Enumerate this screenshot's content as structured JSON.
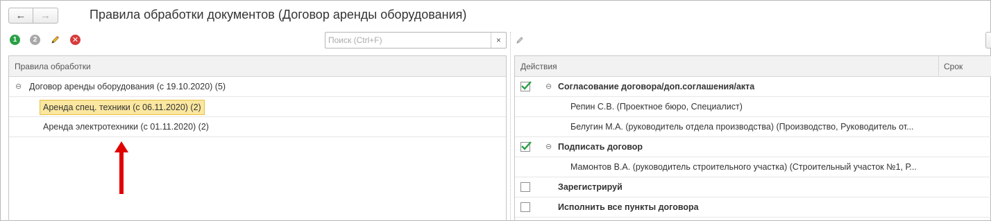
{
  "window": {
    "title": "Правила обработки документов (Договор аренды оборудования)",
    "nav_back": "←",
    "nav_forward": "→"
  },
  "left_toolbar": {
    "icon_1": "1",
    "icon_2": "2",
    "icon_x": "✕",
    "search_placeholder": "Поиск (Ctrl+F)",
    "search_value": "",
    "search_clear": "×"
  },
  "rules_panel": {
    "header": "Правила обработки",
    "rows": [
      {
        "label": "Договор аренды оборудования (с 19.10.2020) (5)",
        "collapse": "⊖"
      },
      {
        "label": "Аренда спец. техники (с 06.11.2020) (2)",
        "selected": true
      },
      {
        "label": "Аренда электротехники (с 01.11.2020) (2)"
      }
    ]
  },
  "actions_panel": {
    "col_actions": "Действия",
    "col_term": "Срок",
    "rows": [
      {
        "label": "Согласование договора/доп.соглашения/акта",
        "checked": true,
        "bold": true,
        "collapse": "⊖"
      },
      {
        "label": "Репин С.В. (Проектное бюро, Специалист)"
      },
      {
        "label": "Белугин М.А. (руководитель отдела производства) (Производство, Руководитель от..."
      },
      {
        "label": "Подписать договор",
        "checked": true,
        "bold": true,
        "collapse": "⊖"
      },
      {
        "label": "Мамонтов В.А. (руководитель строительного участка) (Строительный участок №1, Р..."
      },
      {
        "label": "Зарегистрируй",
        "checked": false,
        "bold": true
      },
      {
        "label": "Исполнить все пункты договора",
        "checked": false,
        "bold": true
      }
    ]
  },
  "icons": {
    "pencil": "pencil-icon",
    "checkmark": "checkmark-icon",
    "arrow": "red-up-arrow"
  },
  "colors": {
    "selection_fill": "#fbe7a0",
    "selection_border": "#e8c040",
    "check_green": "#2aa046",
    "arrow_red": "#e00000"
  }
}
